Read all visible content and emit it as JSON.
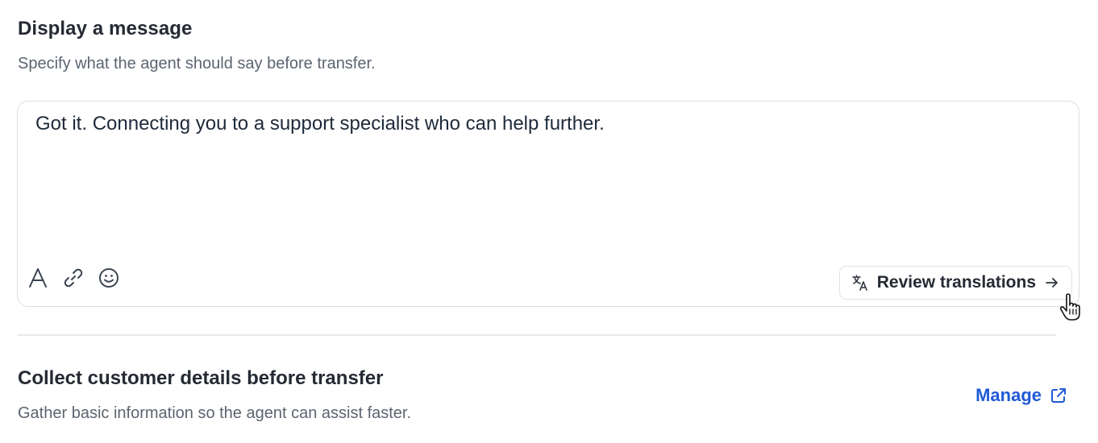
{
  "message_section": {
    "title": "Display a message",
    "subtitle": "Specify what the agent should say before transfer.",
    "editor_text": "Got it. Connecting you to a support specialist who can help further.",
    "toolbar": {
      "icons": [
        "text-format-icon",
        "link-icon",
        "emoji-icon"
      ]
    },
    "review_button": {
      "label": "Review translations",
      "icon": "translate-icon",
      "trailing_icon": "arrow-right-icon"
    }
  },
  "collect_section": {
    "title": "Collect customer details before transfer",
    "subtitle": "Gather basic information so the agent can assist faster.",
    "manage_link": {
      "label": "Manage",
      "icon": "external-link-icon"
    }
  },
  "colors": {
    "accent_link": "#1f5bd6",
    "border": "#d9dde2",
    "text_primary": "#252a33",
    "text_secondary": "#5c6470"
  }
}
